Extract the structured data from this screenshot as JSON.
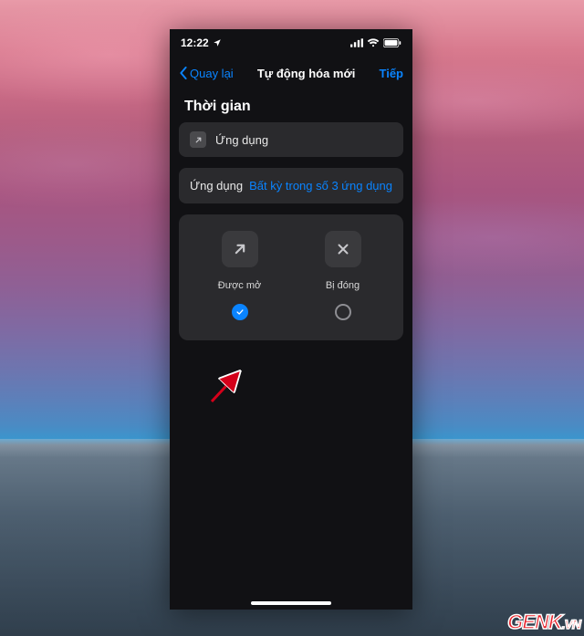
{
  "statusbar": {
    "time": "12:22"
  },
  "navbar": {
    "back_label": "Quay lại",
    "title": "Tự động hóa mới",
    "next_label": "Tiếp"
  },
  "section": {
    "title": "Thời gian"
  },
  "app_row": {
    "label": "Ứng dụng"
  },
  "selector_row": {
    "label": "Ứng dụng",
    "value": "Bất kỳ trong số 3 ứng dụng"
  },
  "options": {
    "opened": {
      "label": "Được mở",
      "selected": true
    },
    "closed": {
      "label": "Bị đóng",
      "selected": false
    }
  },
  "watermark": {
    "text": "GENK",
    "suffix": ".VN"
  },
  "colors": {
    "accent": "#0a84ff"
  }
}
